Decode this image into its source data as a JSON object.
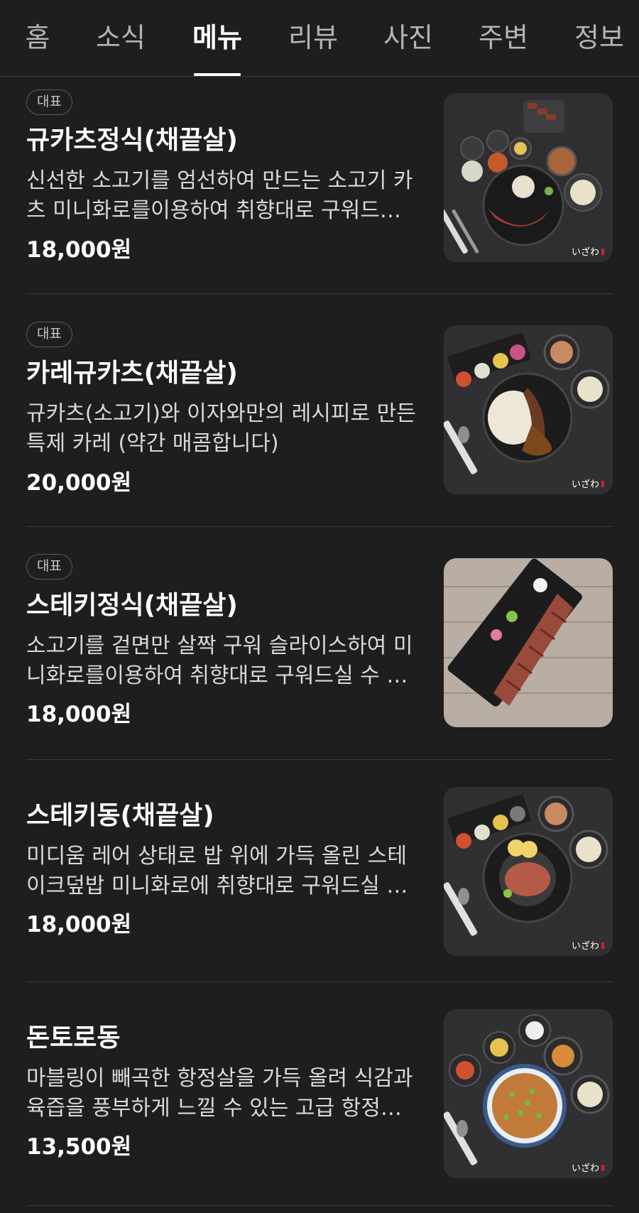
{
  "tabs": [
    {
      "label": "홈"
    },
    {
      "label": "소식"
    },
    {
      "label": "메뉴"
    },
    {
      "label": "리뷰"
    },
    {
      "label": "사진"
    },
    {
      "label": "주변"
    },
    {
      "label": "정보"
    }
  ],
  "active_tab": "메뉴",
  "menu": [
    {
      "badge": "대표",
      "name": "규카츠정식(채끝살)",
      "desc": "신선한 소고기를 엄선하여 만드는 소고기 카츠 미니화로를이용하여 취향대로 구워드실 수 있습니다",
      "price": "18,000원",
      "image": "gyukatsu-set-photo"
    },
    {
      "badge": "대표",
      "name": "카레규카츠(채끝살)",
      "desc": "규카츠(소고기)와 이자와만의 레시피로 만든 특제 카레 (약간 매콤합니다)",
      "price": "20,000원",
      "image": "curry-gyukatsu-photo"
    },
    {
      "badge": "대표",
      "name": "스테키정식(채끝살)",
      "desc": "소고기를 겉면만 살짝 구워 슬라이스하여 미니화로를이용하여 취향대로 구워드실 수 있습니다",
      "price": "18,000원",
      "image": "steak-set-photo"
    },
    {
      "badge": "",
      "name": "스테키동(채끝살)",
      "desc": "미디움 레어 상태로 밥 위에 가득 올린 스테이크덮밥 미니화로에 취향대로 구워드실 수 있습니다",
      "price": "18,000원",
      "image": "steak-don-photo"
    },
    {
      "badge": "",
      "name": "돈토로동",
      "desc": "마블링이 빼곡한 항정살을 가득 올려 식감과 육즙을 풍부하게 느낄 수 있는 고급 항정살 덮밥",
      "price": "13,500원",
      "image": "tontoro-don-photo"
    }
  ],
  "photo_watermark": "いざわ",
  "colors": {
    "background": "#1e1e1f",
    "text_primary": "#ffffff",
    "text_secondary": "#d9d9db",
    "tab_inactive": "#b4b4b6",
    "divider": "#3a3a3c"
  }
}
